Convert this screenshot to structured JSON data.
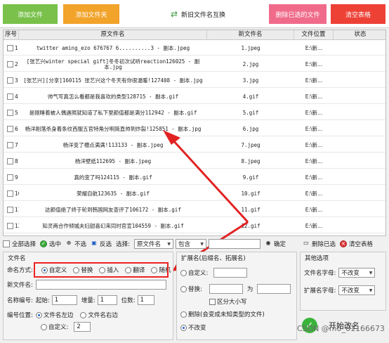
{
  "toolbar": {
    "add_file": "添加文件",
    "add_folder": "添加文件夹",
    "swap": "新旧文件名互换",
    "remove_selected": "删除已选的文件",
    "clear": "清空表格"
  },
  "table": {
    "headers": [
      "序号",
      "原文件名",
      "新文件名",
      "文件位置",
      "状态"
    ],
    "rows": [
      {
        "no": "1",
        "name": "twitter aming_ezo 676767 6..........3 - 副本.jpeg",
        "new": "1.jpeg",
        "loc": "E:\\新..."
      },
      {
        "no": "2",
        "name": "[张艺兴winter special gift]冬冬初次试听reaction126025 - 副本.jpg",
        "new": "2.jpg",
        "loc": "E:\\新..."
      },
      {
        "no": "3",
        "name": "[张艺兴][分享]160115 张艺兴这个冬天有你很温暖!127408 - 副本.jpg",
        "new": "3.jpg",
        "loc": "E:\\新..."
      },
      {
        "no": "4",
        "name": "帅气写真怎么看都是我喜欢的类型128715 - 副本.gif",
        "new": "4.gif",
        "loc": "E:\\新..."
      },
      {
        "no": "5",
        "name": "是刚睡着被人偶遇照就知道了私下里颜值都是满分112942 - 副本.gif",
        "new": "5.gif",
        "loc": "E:\\新..."
      },
      {
        "no": "6",
        "name": "杨洋刚落杀身着条纹西服五官特角分明简直帅到炸裂!125851 - 副本.jpg",
        "new": "6.jpg",
        "loc": "E:\\新..."
      },
      {
        "no": "7",
        "name": "杨洋变了槽点满满!113133 - 副本.jpeg",
        "new": "7.jpeg",
        "loc": "E:\\新..."
      },
      {
        "no": "8",
        "name": "杨洋壁纸112695 - 副本.jpeg",
        "new": "8.jpeg",
        "loc": "E:\\新..."
      },
      {
        "no": "9",
        "name": "真的变了吗124115 - 副本.gif",
        "new": "9.gif",
        "loc": "E:\\新..."
      },
      {
        "no": "10",
        "name": "荣耀自航123635 - 副本.gif",
        "new": "10.gif",
        "loc": "E:\\新..."
      },
      {
        "no": "11",
        "name": "这颜值绝了终于轮到韩国网友查评了106172 - 副本.gif",
        "new": "11.gif",
        "loc": "E:\\新..."
      },
      {
        "no": "12",
        "name": "知灵两合作倾城夫妇甜喜幻来同时官宣104559 - 副本.gif",
        "new": "12.gif",
        "loc": "E:\\新..."
      }
    ]
  },
  "selection_bar": {
    "select_all": "全部选择",
    "select_checked": "选中",
    "deselect": "不选",
    "invert": "反选",
    "choose_label": "选择:",
    "field_value": "原文件名",
    "match_value": "包含",
    "confirm": "确定",
    "delete_selected": "删除已选",
    "clear_table": "清空表格"
  },
  "filename_panel": {
    "title": "文件名",
    "mode_label": "命名方式:",
    "modes": [
      "自定义",
      "替换",
      "插入",
      "翻译",
      "随机"
    ],
    "new_name_label": "新文件名:",
    "numbering_label": "名称编号:",
    "start_label": "起始:",
    "start_value": "1",
    "step_label": "增量:",
    "step_value": "1",
    "digits_label": "位数:",
    "digits_value": "1",
    "position_label": "编号位置:",
    "pos_left": "文件名左边",
    "pos_right": "文件名右边",
    "pos_custom": "自定义:",
    "pos_custom_value": "2"
  },
  "ext_panel": {
    "title": "扩展名(后缀名、拓展名)",
    "custom": "自定义:",
    "replace": "替换:",
    "as_label": "为",
    "case_sensitive": "区分大小写",
    "delete": "删除(会变成未知类型的文件)",
    "no_change": "不改变"
  },
  "other_panel": {
    "title": "其他选项",
    "name_case_label": "文件名字母:",
    "name_case_value": "不改变",
    "ext_case_label": "扩展名字母:",
    "ext_case_value": "不改变"
  },
  "start_button": "开始改名",
  "watermark": "CSDN @m0_61166673",
  "colors": {
    "add_file": "#79c14a",
    "add_folder": "#f2a32a",
    "remove_selected": "#f06b8a",
    "clear": "#ee4136",
    "annotation": "#e22222"
  }
}
